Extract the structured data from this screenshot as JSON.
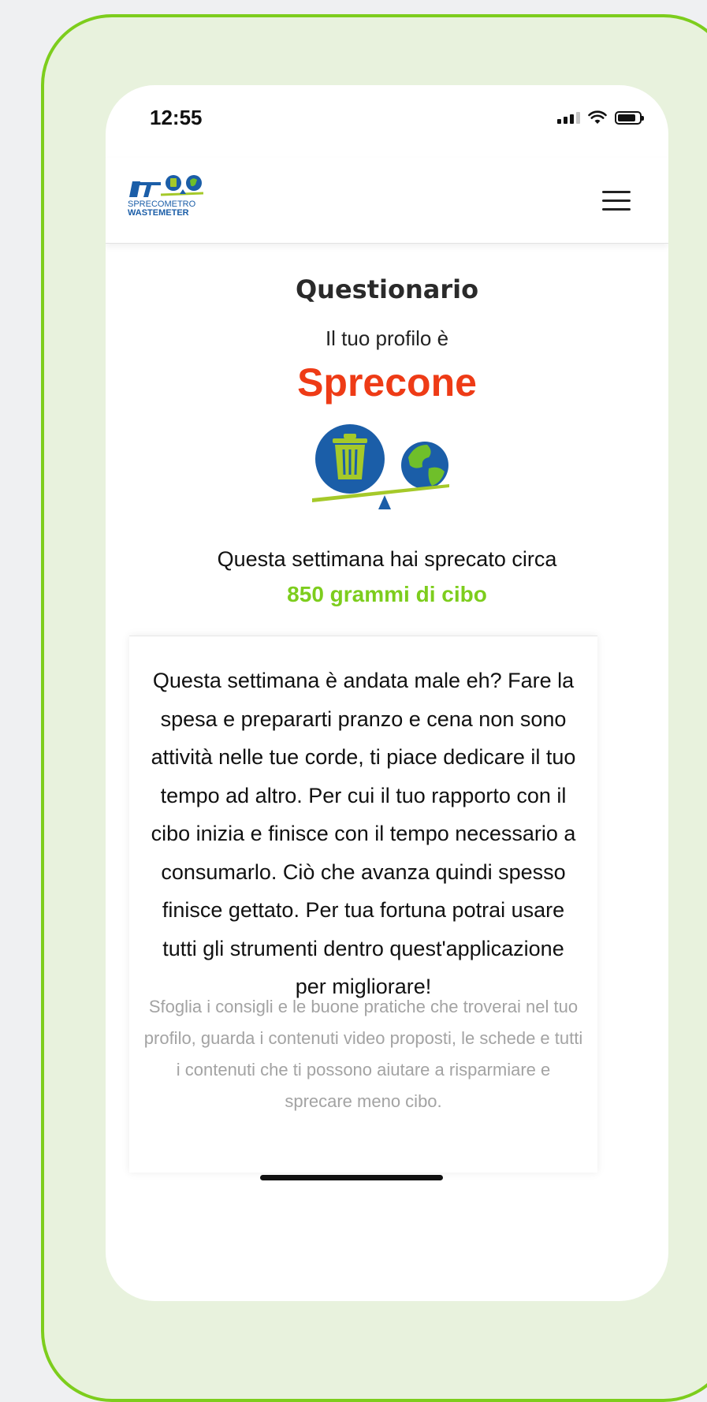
{
  "status": {
    "time": "12:55"
  },
  "header": {
    "logo_line1": "SPRECOMETRO",
    "logo_line2": "WASTEMETER"
  },
  "main": {
    "title": "Questionario",
    "profile_intro": "Il tuo profilo è",
    "profile_name": "Sprecone",
    "weekly_text": "Questa settimana hai sprecato circa",
    "weekly_amount": "850 grammi di cibo"
  },
  "card": {
    "main_text": "Questa settimana è andata male eh? Fare la spesa e prepararti pranzo e cena non sono attività nelle tue corde, ti piace dedicare il tuo tempo ad altro. Per cui il tuo rapporto con il cibo inizia e finisce con il tempo necessario a consumarlo. Ciò che avanza quindi spesso finisce gettato. Per tua fortuna potrai usare tutti gli strumenti dentro quest'applicazione per migliorare!",
    "secondary_text": "Sfoglia i consigli e le buone pratiche che troverai nel tuo profilo, guarda i contenuti video proposti, le schede e tutti i contenuti che ti possono aiutare a risparmiare e sprecare meno cibo."
  },
  "colors": {
    "accent_green": "#7dcd1d",
    "profile_red": "#ee3b16",
    "brand_blue": "#1b5ea8"
  },
  "icons": [
    "signal-icon",
    "wifi-icon",
    "battery-icon",
    "menu-icon",
    "trash-bin-icon",
    "globe-icon"
  ]
}
